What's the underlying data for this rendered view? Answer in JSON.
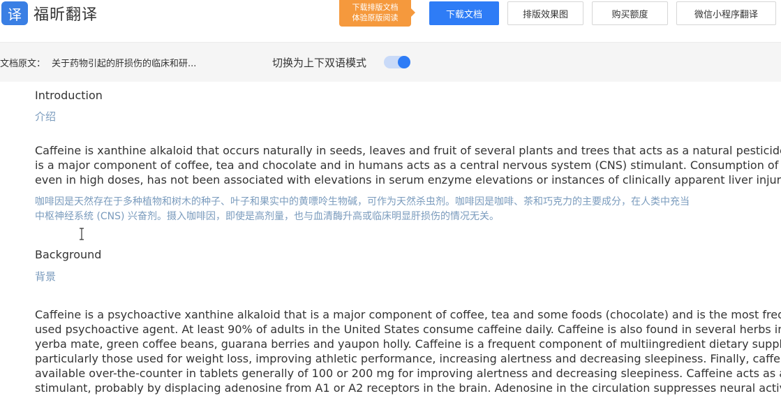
{
  "header": {
    "logo_glyph": "译",
    "logo_text": "福昕翻译",
    "promo_line1": "下载排版文档",
    "promo_line2": "体验原版阅读",
    "buttons": {
      "download": "下载文档",
      "layout_preview": "排版效果图",
      "buy_quota": "购买额度",
      "wechat_miniprogram": "微信小程序翻译"
    }
  },
  "subbar": {
    "doc_label": "文档原文：",
    "doc_title": "关于药物引起的肝损伤的临床和研...",
    "mode_label": "切换为上下双语模式",
    "mode_enabled": true
  },
  "content": {
    "intro_heading": "Introduction",
    "intro_heading_trans": "介绍",
    "intro_para_lines": [
      "Caffeine is xanthine alkaloid that occurs naturally in seeds, leaves and fruit of several plants and trees that acts as a natural pesticide. Caffeine",
      "is a major component of coffee, tea and chocolate and in humans acts as a central nervous system (CNS) stimulant. Consumption of caffeine,",
      "even in high doses, has not been associated with elevations in serum enzyme elevations or instances of clinically apparent liver injury."
    ],
    "intro_trans_lines": [
      "咖啡因是天然存在于多种植物和树木的种子、叶子和果实中的黄嘌呤生物碱，可作为天然杀虫剂。咖啡因是咖啡、茶和巧克力的主要成分，在人类中充当",
      "中枢神经系统 (CNS) 兴奋剂。摄入咖啡因，即使是高剂量，也与血清酶升高或临床明显肝损伤的情况无关。"
    ],
    "bg_heading": "Background",
    "bg_heading_trans": "背景",
    "bg_para_lines": [
      "Caffeine is a psychoactive xanthine alkaloid that is a major component of coffee, tea and some foods (chocolate) and is the most frequently",
      "used psychoactive agent. At least 90% of adults in the United States consume caffeine daily. Caffeine is also found in several herbs including",
      "yerba mate, green coffee beans, guarana berries and yaupon holly. Caffeine is a frequent component of multiingredient dietary supplements,",
      "particularly those used for weight loss, improving athletic performance, increasing alertness and decreasing sleepiness. Finally, caffeine is",
      "available over-the-counter in tablets generally of 100 or 200 mg for improving alertness and decreasing sleepiness. Caffeine acts as a CNS",
      "stimulant, probably by displacing adenosine from A1 or A2 receptors in the brain. Adenosine in the circulation suppresses neural activity and"
    ]
  }
}
